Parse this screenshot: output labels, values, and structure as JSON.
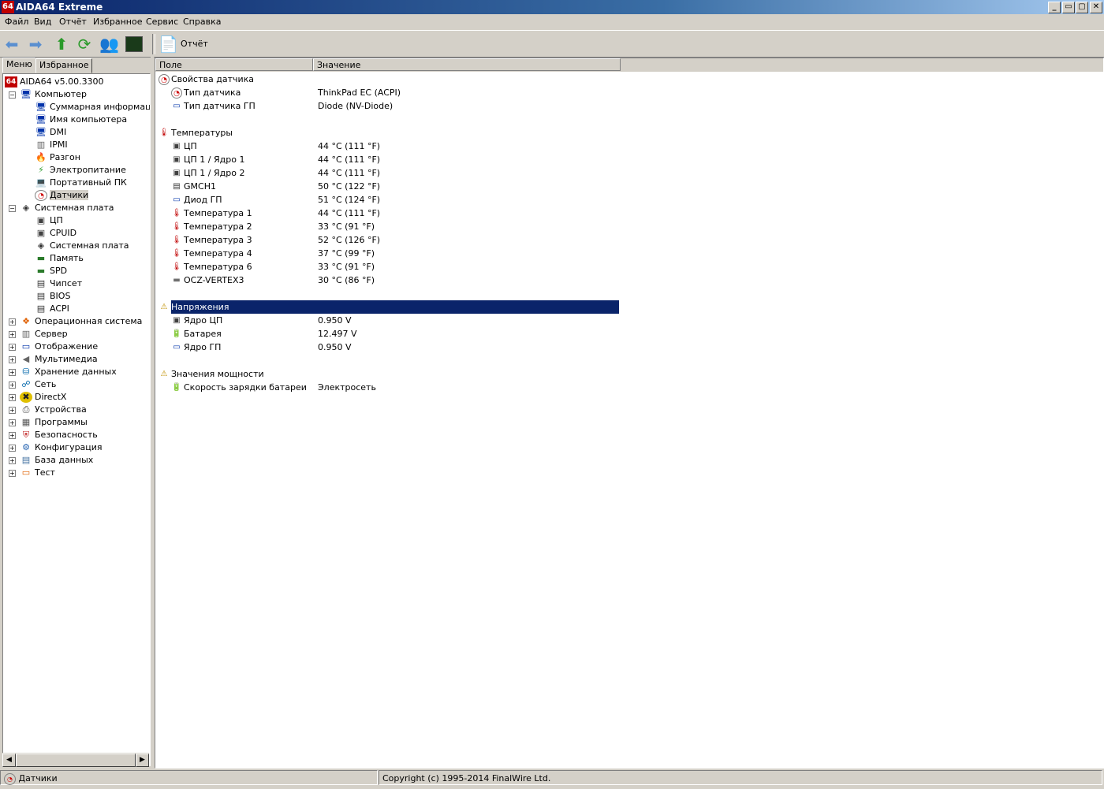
{
  "window": {
    "title": "AIDA64 Extreme",
    "app_icon_text": "64"
  },
  "menu": [
    "Файл",
    "Вид",
    "Отчёт",
    "Избранное",
    "Сервис",
    "Справка"
  ],
  "toolbar": {
    "report_label": "Отчёт"
  },
  "left_tabs": {
    "menu": "Меню",
    "favorites": "Избранное"
  },
  "tree": [
    {
      "label": "AIDA64 v5.00.3300",
      "icon": "aida64-logo-icon"
    },
    {
      "label": "Компьютер",
      "icon": "computer-icon"
    },
    {
      "label": "Суммарная информация",
      "icon": "computer-icon"
    },
    {
      "label": "Имя компьютера",
      "icon": "computer-icon"
    },
    {
      "label": "DMI",
      "icon": "computer-icon"
    },
    {
      "label": "IPMI",
      "icon": "server-icon"
    },
    {
      "label": "Разгон",
      "icon": "flame-icon"
    },
    {
      "label": "Электропитание",
      "icon": "power-icon"
    },
    {
      "label": "Портативный ПК",
      "icon": "laptop-icon"
    },
    {
      "label": "Датчики",
      "icon": "sensor-icon"
    },
    {
      "label": "Системная плата",
      "icon": "motherboard-icon"
    },
    {
      "label": "ЦП",
      "icon": "cpu-icon"
    },
    {
      "label": "CPUID",
      "icon": "cpu-icon"
    },
    {
      "label": "Системная плата",
      "icon": "motherboard-icon"
    },
    {
      "label": "Память",
      "icon": "memory-icon"
    },
    {
      "label": "SPD",
      "icon": "memory-icon"
    },
    {
      "label": "Чипсет",
      "icon": "chip-icon"
    },
    {
      "label": "BIOS",
      "icon": "chip-icon"
    },
    {
      "label": "ACPI",
      "icon": "chip-icon"
    },
    {
      "label": "Операционная система",
      "icon": "windows-icon"
    },
    {
      "label": "Сервер",
      "icon": "server-icon"
    },
    {
      "label": "Отображение",
      "icon": "monitor-icon"
    },
    {
      "label": "Мультимедиа",
      "icon": "speaker-icon"
    },
    {
      "label": "Хранение данных",
      "icon": "storage-icon"
    },
    {
      "label": "Сеть",
      "icon": "network-icon"
    },
    {
      "label": "DirectX",
      "icon": "directx-icon"
    },
    {
      "label": "Устройства",
      "icon": "devices-icon"
    },
    {
      "label": "Программы",
      "icon": "programs-icon"
    },
    {
      "label": "Безопасность",
      "icon": "shield-icon"
    },
    {
      "label": "Конфигурация",
      "icon": "config-icon"
    },
    {
      "label": "База данных",
      "icon": "database-icon"
    },
    {
      "label": "Тест",
      "icon": "benchmark-icon"
    }
  ],
  "columns": {
    "field": "Поле",
    "value": "Значение"
  },
  "list": [
    {
      "type": "group",
      "field": "Свойства датчика",
      "icon": "sensor-icon"
    },
    {
      "type": "item",
      "field": "Тип датчика",
      "value": "ThinkPad EC  (ACPI)",
      "icon": "sensor-icon"
    },
    {
      "type": "item",
      "field": "Тип датчика ГП",
      "value": "Diode  (NV-Diode)",
      "icon": "monitor-icon"
    },
    {
      "type": "group",
      "field": "Температуры",
      "icon": "thermometer-icon"
    },
    {
      "type": "item",
      "field": "ЦП",
      "value": "44 °C  (111 °F)",
      "icon": "cpu-icon"
    },
    {
      "type": "item",
      "field": "ЦП 1 / Ядро 1",
      "value": "44 °C  (111 °F)",
      "icon": "cpu-icon"
    },
    {
      "type": "item",
      "field": "ЦП 1 / Ядро 2",
      "value": "44 °C  (111 °F)",
      "icon": "cpu-icon"
    },
    {
      "type": "item",
      "field": "GMCH1",
      "value": "50 °C  (122 °F)",
      "icon": "chip-icon"
    },
    {
      "type": "item",
      "field": "Диод ГП",
      "value": "51 °C  (124 °F)",
      "icon": "monitor-icon"
    },
    {
      "type": "item",
      "field": "Температура 1",
      "value": "44 °C  (111 °F)",
      "icon": "thermometer-icon"
    },
    {
      "type": "item",
      "field": "Температура 2",
      "value": "33 °C  (91 °F)",
      "icon": "thermometer-icon"
    },
    {
      "type": "item",
      "field": "Температура 3",
      "value": "52 °C  (126 °F)",
      "icon": "thermometer-icon"
    },
    {
      "type": "item",
      "field": "Температура 4",
      "value": "37 °C  (99 °F)",
      "icon": "thermometer-icon"
    },
    {
      "type": "item",
      "field": "Температура 6",
      "value": "33 °C  (91 °F)",
      "icon": "thermometer-icon"
    },
    {
      "type": "item",
      "field": "OCZ-VERTEX3",
      "value": "30 °C  (86 °F)",
      "icon": "disk-icon"
    },
    {
      "type": "group",
      "field": "Напряжения",
      "icon": "warning-icon",
      "selected": true
    },
    {
      "type": "item",
      "field": "Ядро ЦП",
      "value": "0.950 V",
      "icon": "cpu-icon"
    },
    {
      "type": "item",
      "field": "Батарея",
      "value": "12.497 V",
      "icon": "battery-icon"
    },
    {
      "type": "item",
      "field": "Ядро ГП",
      "value": "0.950 V",
      "icon": "monitor-icon"
    },
    {
      "type": "group",
      "field": "Значения мощности",
      "icon": "warning-icon"
    },
    {
      "type": "item",
      "field": "Скорость зарядки батареи",
      "value": "Электросеть",
      "icon": "battery-icon"
    }
  ],
  "status": {
    "left": "Датчики",
    "right": "Copyright (c) 1995-2014 FinalWire Ltd."
  },
  "colors": {
    "title_start": "#0a246a",
    "selection": "#0a246a",
    "face": "#d4d0c8"
  }
}
